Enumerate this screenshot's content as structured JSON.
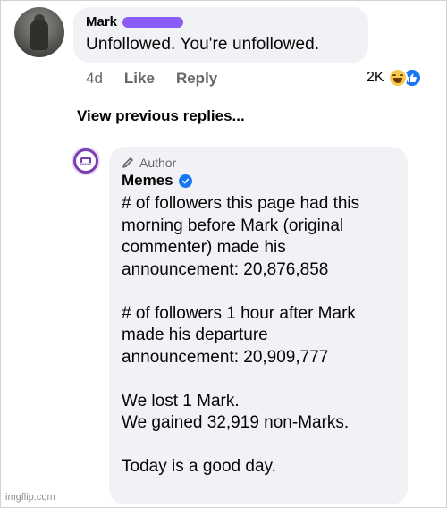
{
  "comment1": {
    "author": "Mark",
    "text": "Unfollowed.  You're unfollowed.",
    "time": "4d",
    "like_label": "Like",
    "reply_label": "Reply",
    "reaction_count": "2K",
    "reaction_icons": [
      "haha-icon",
      "like-icon"
    ]
  },
  "view_previous_label": "View previous replies...",
  "comment2": {
    "badge_label": "Author",
    "author": "Memes",
    "avatar_label": "MEMES",
    "lines_block1": [
      "# of followers this page had this",
      "morning before Mark (original",
      "commenter) made his",
      "announcement: 20,876,858"
    ],
    "lines_block2": [
      "# of followers 1 hour after Mark",
      "made his departure",
      "announcement: 20,909,777"
    ],
    "lines_block3": [
      "We lost 1 Mark.",
      "We gained 32,919 non-Marks."
    ],
    "lines_block4": [
      "Today is a good day."
    ]
  },
  "watermark": "imgflip.com",
  "colors": {
    "bubble_bg": "#f0f2f5",
    "meta_text": "#65676b",
    "redaction": "#8b5cf6",
    "verified": "#1877f2",
    "memes_brand": "#7a3fb0"
  }
}
